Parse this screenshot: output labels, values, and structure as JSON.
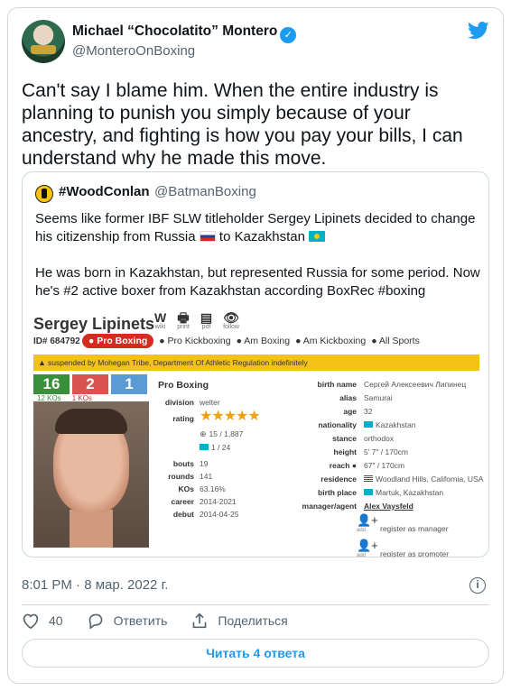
{
  "author": {
    "name": "Michael “Chocolatito” Montero",
    "handle": "@MonteroOnBoxing",
    "verified": true
  },
  "tweet": {
    "text": "Can't say I blame him.  When the entire industry is planning to punish you simply because of your ancestry, and fighting is how you pay your bills, I can understand why he made this move.",
    "timestamp": "8:01 PM · 8 мар. 2022 г.",
    "likes": "40",
    "reply_label": "Ответить",
    "share_label": "Поделиться",
    "read_replies_label": "Читать 4 ответа"
  },
  "quote": {
    "name": "#WoodConlan",
    "handle": "@BatmanBoxing",
    "para1_before": "Seems like former IBF SLW titleholder Sergey Lipinets decided to change his citizenship from Russia ",
    "para1_mid": " to Kazakhstan ",
    "para2": "He was born in Kazakhstan, but represented Russia for some period. Now he's #2 active boxer from Kazakhstan according BoxRec #boxing"
  },
  "boxrec": {
    "boxer_name": "Sergey Lipinets",
    "icons": [
      {
        "icon": "W",
        "label": "wiki"
      },
      {
        "icon": "🖶",
        "label": "print"
      },
      {
        "icon": "▤",
        "label": "pdf"
      },
      {
        "icon": "👁",
        "label": "follow"
      }
    ],
    "id_label": "ID# 684792",
    "tabs": {
      "pro_boxing": "Pro Boxing",
      "pro_kickboxing": "Pro Kickboxing",
      "am_boxing": "Am Boxing",
      "am_kickboxing": "Am Kickboxing",
      "all_sports": "All Sports"
    },
    "suspension": "suspended by Mohegan Tribe, Department Of Athletic Regulation indefinitely",
    "record": {
      "wins": "16",
      "losses": "2",
      "draws": "1",
      "wins_ko": "12 KOs",
      "losses_ko": "1 KOs"
    },
    "pro_heading": "Pro Boxing",
    "left": {
      "division_k": "division",
      "division_v": "welter",
      "rating_k": "rating",
      "stars": "★★★★★",
      "rank_world": "15 / 1,887",
      "rank_country": "1 / 24",
      "bouts_k": "bouts",
      "bouts_v": "19",
      "rounds_k": "rounds",
      "rounds_v": "141",
      "kos_k": "KOs",
      "kos_v": "63.16%",
      "career_k": "career",
      "career_v": "2014-2021",
      "debut_k": "debut",
      "debut_v": "2014-04-25"
    },
    "right": {
      "birth_name_k": "birth name",
      "birth_name_v": "Сергей Алексеевич Липинец",
      "alias_k": "alias",
      "alias_v": "Samurai",
      "age_k": "age",
      "age_v": "32",
      "nationality_k": "nationality",
      "nationality_v": "Kazakhstan",
      "stance_k": "stance",
      "stance_v": "orthodox",
      "height_k": "height",
      "height_v": "5′ 7″  /  170cm",
      "reach_k": "reach",
      "reach_v": "67″  /  170cm",
      "residence_k": "residence",
      "residence_v": "Woodland Hills, California, USA",
      "birth_place_k": "birth place",
      "birth_place_v": "Martuk, Kazakhstan",
      "manager_k": "manager/agent",
      "manager_v": "Alex Vaysfeld",
      "add_label": "add",
      "register_manager": "register as manager",
      "register_promoter": "register as promoter"
    }
  },
  "colors": {
    "accent": "#1d9bf0",
    "text_secondary": "#536471",
    "border": "#cfd9de"
  }
}
